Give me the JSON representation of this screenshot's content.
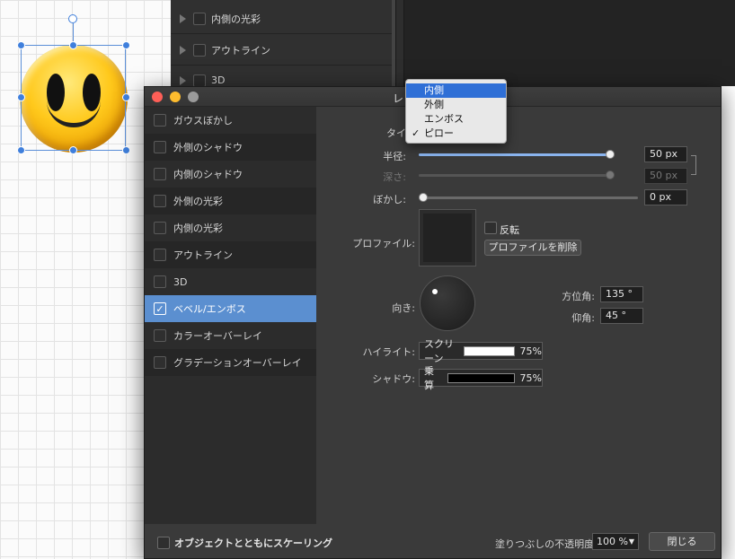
{
  "background_panel": {
    "rows": [
      "内側の光彩",
      "アウトライン",
      "3D"
    ]
  },
  "dialog": {
    "title": "レ",
    "effects": [
      {
        "label": "ガウスぼかし",
        "checked": false
      },
      {
        "label": "外側のシャドウ",
        "checked": false
      },
      {
        "label": "内側のシャドウ",
        "checked": false
      },
      {
        "label": "外側の光彩",
        "checked": false
      },
      {
        "label": "内側の光彩",
        "checked": false
      },
      {
        "label": "アウトライン",
        "checked": false
      },
      {
        "label": "3D",
        "checked": false
      },
      {
        "label": "ベベル/エンボス",
        "checked": true
      },
      {
        "label": "カラーオーバーレイ",
        "checked": false
      },
      {
        "label": "グラデーションオーバーレイ",
        "checked": false
      }
    ],
    "check_mark": "✓",
    "settings": {
      "type_label": "タイ",
      "radius_label": "半径:",
      "radius_value": "50 px",
      "radius_fraction": 1.0,
      "depth_label": "深さ:",
      "depth_value": "50 px",
      "blur_label": "ぼかし:",
      "blur_value": "0 px",
      "profile_label": "プロファイル:",
      "invert_label": "反転",
      "delete_profile_label": "プロファイルを削除",
      "direction_label": "向き:",
      "azimuth_label": "方位角:",
      "azimuth_value": "135 °",
      "elevation_label": "仰角:",
      "elevation_value": "45 °",
      "highlight_label": "ハイライト:",
      "highlight_mode": "スクリーン",
      "highlight_color": "#ffffff",
      "highlight_opacity": "75%",
      "shadow_label": "シャドウ:",
      "shadow_mode": "乗算",
      "shadow_color": "#000000",
      "shadow_opacity": "75%"
    },
    "footer": {
      "scale_with_object_label": "オブジェクトとともにスケーリング",
      "fill_opacity_label": "塗りつぶしの不透明度:",
      "fill_opacity_value": "100 %",
      "close_label": "閉じる"
    }
  },
  "type_dropdown": {
    "options": [
      {
        "label": "内側",
        "highlighted": true,
        "selected": false
      },
      {
        "label": "外側",
        "highlighted": false,
        "selected": false
      },
      {
        "label": "エンボス",
        "highlighted": false,
        "selected": false
      },
      {
        "label": "ピロー",
        "highlighted": false,
        "selected": true
      }
    ]
  },
  "colors": {
    "selection_accent": "#5b8fd0",
    "menu_highlight": "#2f6fd6"
  }
}
